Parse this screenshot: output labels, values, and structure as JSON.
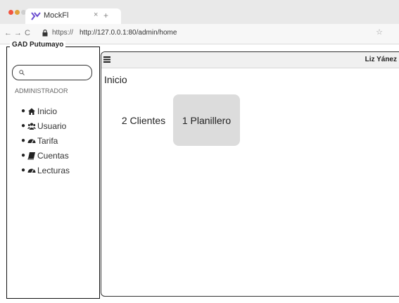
{
  "browser": {
    "tab_title": "MockFl",
    "new_tab_icon": "+",
    "close_icon": "×",
    "url_scheme": "https://",
    "url": "http://127.0.0.1:80/admin/home",
    "colors": {
      "dot_red": "#f2543f",
      "dot_yellow": "#e0a13b",
      "dot_green": "#c8c8c8",
      "tab_logo": "#6a4cd0"
    }
  },
  "sidebar": {
    "brand": "GAD Putumayo",
    "search_placeholder": "",
    "role_label": "ADMINISTRADOR",
    "items": [
      {
        "label": "Inicio",
        "icon": "home-icon"
      },
      {
        "label": "Usuario",
        "icon": "users-icon"
      },
      {
        "label": "Tarifa",
        "icon": "tachometer-icon"
      },
      {
        "label": "Cuentas",
        "icon": "book-icon"
      },
      {
        "label": "Lecturas",
        "icon": "tachometer-icon"
      }
    ]
  },
  "header": {
    "user_name": "Liz Yánez"
  },
  "main": {
    "page_title": "Inicio",
    "cards": [
      {
        "label": "2 Clientes"
      },
      {
        "label": "1 Planillero"
      }
    ]
  }
}
